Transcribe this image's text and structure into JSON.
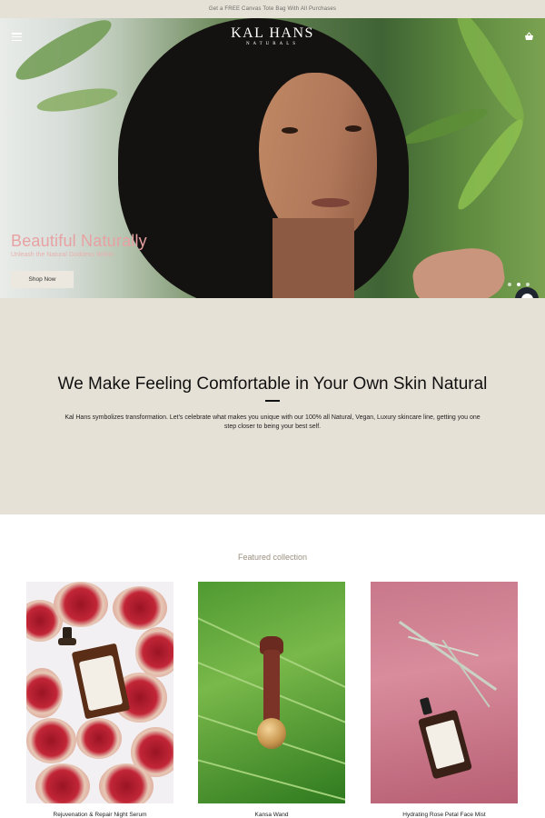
{
  "announcement": {
    "text": "Get a FREE Canvas Tote Bag With All Purchases"
  },
  "header": {
    "logo_line1": "KAL HANS",
    "logo_line2": "NATURALS",
    "menu_icon": "hamburger-menu-icon",
    "cart_icon": "basket-icon"
  },
  "hero": {
    "title": "Beautiful Naturally",
    "subtitle": "Unleash the Natural Goddess Within",
    "cta_label": "Shop Now",
    "slides": 3,
    "active_slide": 2
  },
  "intro": {
    "heading": "We Make Feeling Comfortable in Your Own Skin Natural",
    "body": "Kal Hans symbolizes transformation. Let's celebrate what makes you unique with our 100% all Natural, Vegan, Luxury skincare line, getting you one step closer to being your best self."
  },
  "featured": {
    "title": "Featured collection",
    "products": [
      {
        "name": "Rejuvenation & Repair Night Serum"
      },
      {
        "name": "Kansa Wand"
      },
      {
        "name": "Hydrating Rose Petal Face Mist"
      }
    ]
  },
  "colors": {
    "announce_bg": "#e6e1d6",
    "hero_title": "#e8a1a3",
    "intro_bg": "#e6e1d6",
    "featured_title": "#9a8f7f"
  }
}
